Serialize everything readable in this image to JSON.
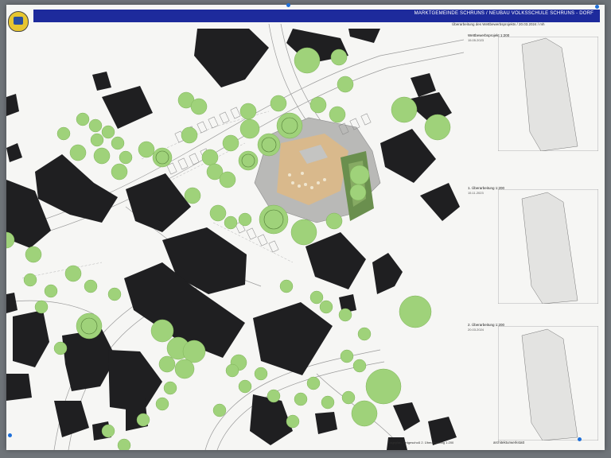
{
  "header": {
    "title": "MARKTGEMEINDE SCHRUNS / NEUBAU VOLKSSCHULE SCHRUNS - DORF",
    "subtitle": "Überarbeitung des Wettbewerbsprojekts / 20.03.2024 / mh"
  },
  "panels": [
    {
      "label": "Wettbewerbsprojekt 1:200",
      "date": "15.05.2023"
    },
    {
      "label": "1. Überarbeitung 1:200",
      "date": "15.11.2023"
    },
    {
      "label": "2. Überarbeitung 1:200",
      "date": "20.03.2024"
    }
  ],
  "footer": {
    "legend": "Lageplan, Erdgeschoß 2. Überarbeitung 1:200",
    "firm": "architekturwerkstatt"
  },
  "colors": {
    "banner": "#1d2a9c",
    "building": "#1f1f21",
    "tree": "#9fd27a",
    "school": "#b9b9b7",
    "courtyard": "#d9b98c"
  }
}
